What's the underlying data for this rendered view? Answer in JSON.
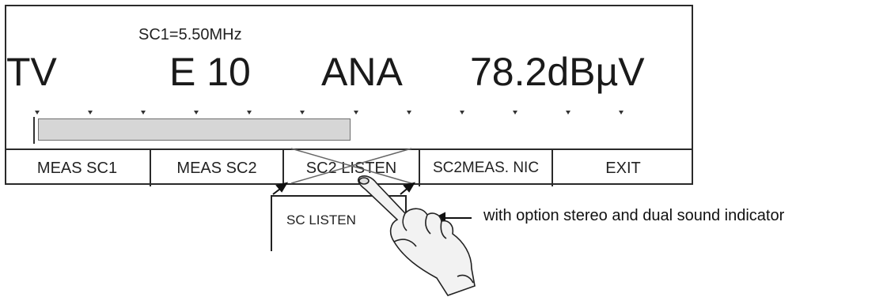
{
  "display": {
    "subcarrier": "SC1=5.50MHz",
    "mode": "TV",
    "channel": "E 10",
    "standard": "ANA",
    "level": "78.2dBµV",
    "level_bar_fill_fraction": 0.5,
    "tick_count": 12
  },
  "softkeys": [
    {
      "label": "MEAS SC1"
    },
    {
      "label": "MEAS SC2"
    },
    {
      "label": "SC2 LISTEN"
    },
    {
      "label": "SC2MEAS. NIC"
    },
    {
      "label": "EXIT"
    }
  ],
  "popup": {
    "label": "SC LISTEN"
  },
  "annotation": {
    "note": "with option stereo and dual sound indicator"
  },
  "icons": {
    "pointing_hand": "pointing-hand-icon",
    "arrow": "arrow-icon"
  }
}
